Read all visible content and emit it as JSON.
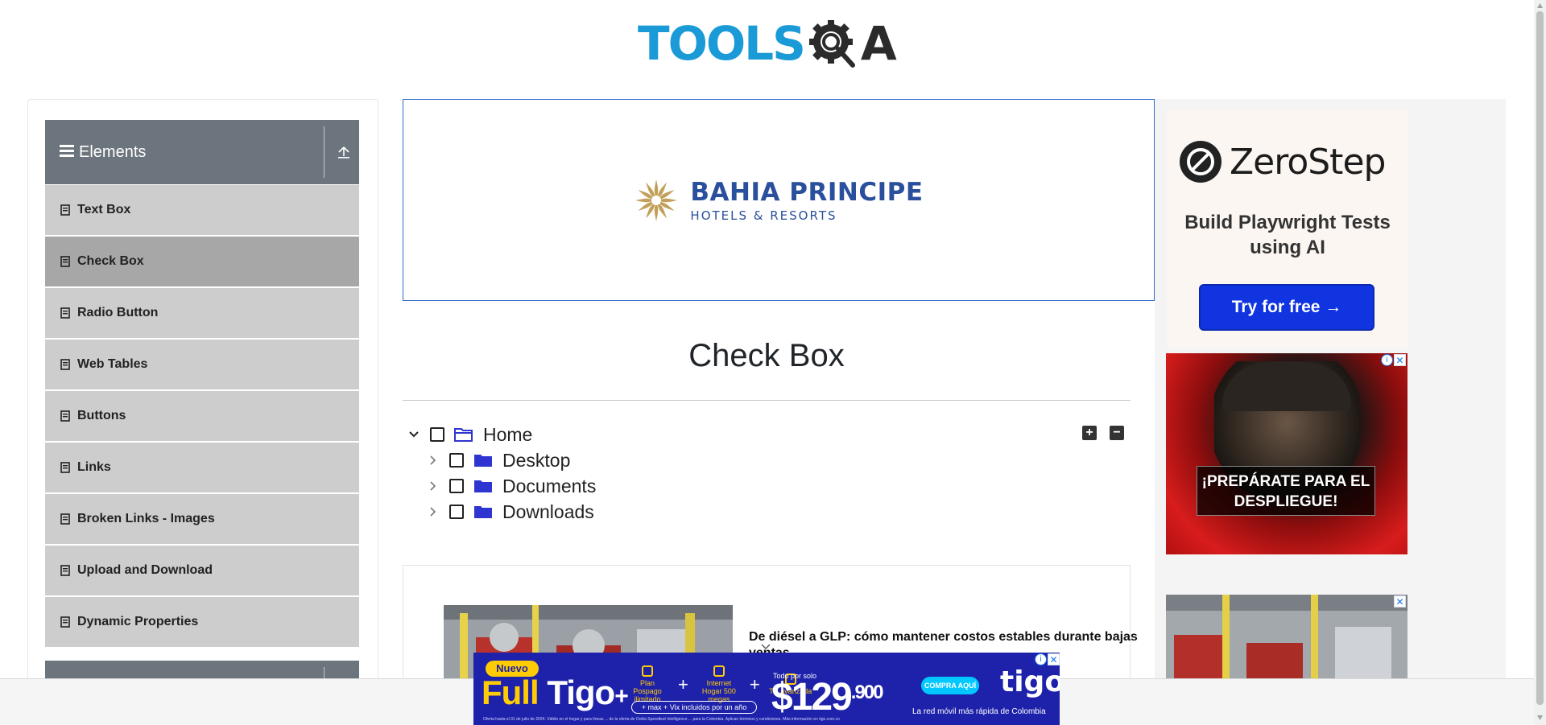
{
  "header": {
    "logo_text_left": "TOOLS",
    "logo_text_right": "A"
  },
  "sidebar": {
    "group_title": "Elements",
    "items": [
      {
        "label": "Text Box",
        "active": false
      },
      {
        "label": "Check Box",
        "active": true
      },
      {
        "label": "Radio Button",
        "active": false
      },
      {
        "label": "Web Tables",
        "active": false
      },
      {
        "label": "Buttons",
        "active": false
      },
      {
        "label": "Links",
        "active": false
      },
      {
        "label": "Broken Links - Images",
        "active": false
      },
      {
        "label": "Upload and Download",
        "active": false
      },
      {
        "label": "Dynamic Properties",
        "active": false
      }
    ]
  },
  "banner_ad": {
    "brand": "BAHIA PRINCIPE",
    "subtitle": "HOTELS & RESORTS"
  },
  "main": {
    "title": "Check Box",
    "tree": [
      {
        "label": "Home",
        "expanded": true,
        "level": 0
      },
      {
        "label": "Desktop",
        "expanded": false,
        "level": 1
      },
      {
        "label": "Documents",
        "expanded": false,
        "level": 1
      },
      {
        "label": "Downloads",
        "expanded": false,
        "level": 1
      }
    ],
    "expand_all_label": "+",
    "collapse_all_label": "−"
  },
  "article": {
    "title": "De diésel a GLP: cómo mantener costos estables durante bajas ventas"
  },
  "right_ads": {
    "zerostep": {
      "name": "ZeroStep",
      "tagline": "Build Playwright Tests using AI",
      "cta": "Try for free →"
    },
    "game_ad": {
      "headline": "¡PREPÁRATE PARA EL DESPLIEGUE!"
    }
  },
  "bottom_ad": {
    "badge": "Nuevo",
    "product_a": "Full",
    "product_b": "Tigo",
    "feature_1": "Plan Pospago ilimitado",
    "feature_2": "Internet Hogar 500 megas",
    "feature_3": "TV avanzada",
    "included": "+ max + Vix incluidos por un año",
    "price_label": "Todo por solo",
    "price": "$129",
    "price_cents": ".900",
    "cta": "COMPRA AQUÍ",
    "brand": "tigo",
    "tagline": "La red móvil más rápida de Colombia",
    "fine_print": "Oferta hasta el 31 de julio de 2024. Válido en el hogar y para líneas ... de la oferta de Ookla Speedtest Intelligence ... para la Colombia. Aplican términos y condiciones. Más información en tigo.com.co"
  },
  "colors": {
    "logo_blue": "#1a9ad6",
    "sidebar_header": "#6c757d",
    "menu_item": "#cdcdcd",
    "menu_item_active": "#a7a7a7",
    "folder": "#2f35d0",
    "zerostep_button": "#1034e0",
    "tigo_blue": "#1e22aa",
    "tigo_yellow": "#ffcb05"
  }
}
